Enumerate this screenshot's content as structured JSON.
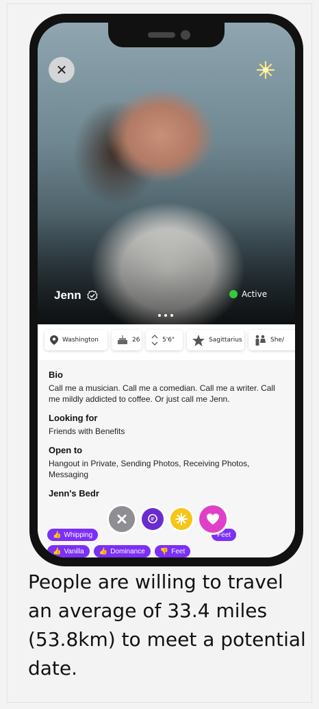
{
  "profile": {
    "name": "Jenn",
    "status": "Active",
    "status_color": "#36c93c"
  },
  "info_chips": [
    {
      "icon": "location-pin-icon",
      "label": "Washington"
    },
    {
      "icon": "birthday-cake-icon",
      "label": "26"
    },
    {
      "icon": "height-arrows-icon",
      "label": "5'6\""
    },
    {
      "icon": "star-icon",
      "label": "Sagittarius"
    },
    {
      "icon": "people-icon",
      "label": "She/"
    }
  ],
  "bio": {
    "title": "Bio",
    "text": "Call me a musician. Call me a comedian. Call me a writer. Call me mildly addicted to coffee. Or just call me Jenn."
  },
  "looking_for": {
    "title": "Looking for",
    "text": "Friends with Benefits"
  },
  "open_to": {
    "title": "Open to",
    "text": "Hangout in Private, Sending Photos, Receiving Photos, Messaging"
  },
  "bedroom": {
    "title": "Jenn's Bedr",
    "tags_row1": [
      {
        "icon": "thumbs-up-icon",
        "label": "Whipping"
      },
      {
        "icon": "thumbs-up-icon",
        "label": "Feet"
      }
    ],
    "tags_row2": [
      {
        "icon": "thumbs-up-icon",
        "label": "Vanilla"
      },
      {
        "icon": "thumbs-up-icon",
        "label": "Dominance"
      },
      {
        "icon": "thumbs-down-icon",
        "label": "Feet"
      }
    ]
  },
  "colors": {
    "tag_purple": "#7b2ff7",
    "pass_gray": "#8e8e93",
    "message_purple": "#6a2ccf",
    "super_yellow": "#f5c518",
    "like_pink": "#e040c8"
  },
  "caption": "People are willing to travel an average of 33.4 miles (53.8km) to meet a potential date."
}
